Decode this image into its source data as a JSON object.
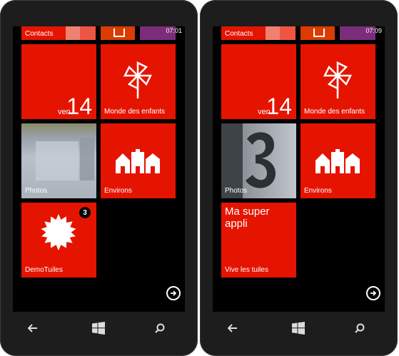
{
  "left": {
    "status_time": "07:01",
    "tiles": {
      "contacts_label": "Contacts",
      "calendar_day": "ven.",
      "calendar_date": "14",
      "kids_label": "Monde des enfants",
      "photos_label": "Photos",
      "nearby_label": "Environs",
      "demo_label": "DemoTuiles",
      "demo_badge": "3"
    }
  },
  "right": {
    "status_time": "07:09",
    "tiles": {
      "contacts_label": "Contacts",
      "calendar_day": "ven.",
      "calendar_date": "14",
      "kids_label": "Monde des enfants",
      "photos_label": "Photos",
      "nearby_label": "Environs",
      "app_title": "Ma super appli",
      "app_label": "Vive les tuiles"
    }
  },
  "icons": {
    "back": "back-arrow-icon",
    "start": "windows-logo-icon",
    "search": "search-icon",
    "more_apps": "arrow-right-circle-icon",
    "pinwheel": "pinwheel-icon",
    "houses": "houses-icon",
    "sun": "sun-burst-icon"
  },
  "colors": {
    "tile_red": "#e51400",
    "office_orange": "#dc3c00",
    "purple": "#7b2d7b",
    "background": "#000000"
  }
}
